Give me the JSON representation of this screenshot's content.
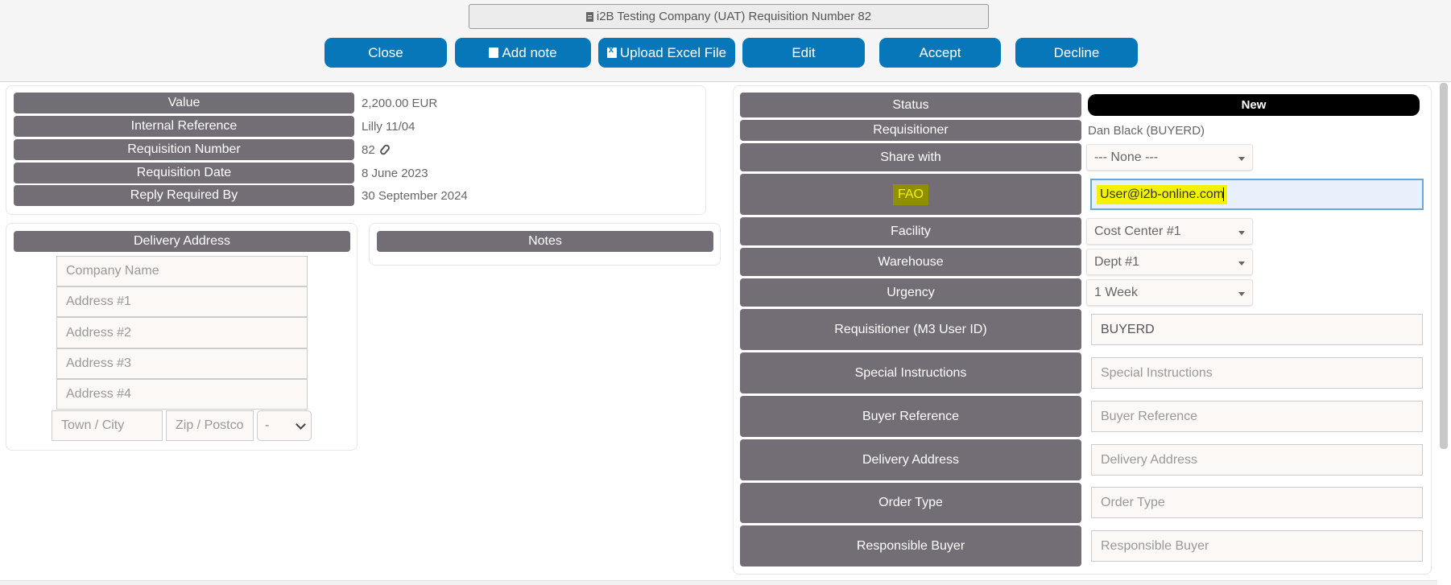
{
  "header": {
    "title": "i2B Testing Company (UAT) Requisition Number 82",
    "buttons": {
      "close": "Close",
      "add_note": "Add note",
      "upload_excel": "Upload Excel File",
      "edit": "Edit",
      "accept": "Accept",
      "decline": "Decline"
    }
  },
  "summary": {
    "value_label": "Value",
    "value": "2,200.00 EUR",
    "internal_ref_label": "Internal Reference",
    "internal_ref": "Lilly 11/04",
    "req_number_label": "Requisition Number",
    "req_number": "82",
    "req_date_label": "Requisition Date",
    "req_date": "8 June 2023",
    "reply_label": "Reply Required By",
    "reply": "30 September 2024"
  },
  "delivery": {
    "heading": "Delivery Address",
    "company_placeholder": "Company Name",
    "address1_placeholder": "Address #1",
    "address2_placeholder": "Address #2",
    "address3_placeholder": "Address #3",
    "address4_placeholder": "Address #4",
    "town_placeholder": "Town / City",
    "zip_placeholder": "Zip / Postco",
    "country_value": "-"
  },
  "notes": {
    "heading": "Notes"
  },
  "details": {
    "status_label": "Status",
    "status_value": "New",
    "requisitioner_label": "Requisitioner",
    "requisitioner_value": "Dan Black (BUYERD)",
    "share_label": "Share with",
    "share_value": "--- None ---",
    "fao_label": "FAO",
    "fao_value": "User@i2b-online.com",
    "facility_label": "Facility",
    "facility_value": "Cost Center #1",
    "warehouse_label": "Warehouse",
    "warehouse_value": "Dept #1",
    "urgency_label": "Urgency",
    "urgency_value": "1 Week",
    "m3_label": "Requisitioner (M3 User ID)",
    "m3_value": "BUYERD",
    "special_label": "Special Instructions",
    "special_placeholder": "Special Instructions",
    "buyer_ref_label": "Buyer Reference",
    "buyer_ref_placeholder": "Buyer Reference",
    "delivery_label": "Delivery Address",
    "delivery_placeholder": "Delivery Address",
    "order_type_label": "Order Type",
    "order_type_placeholder": "Order Type",
    "resp_buyer_label": "Responsible Buyer",
    "resp_buyer_placeholder": "Responsible Buyer"
  }
}
